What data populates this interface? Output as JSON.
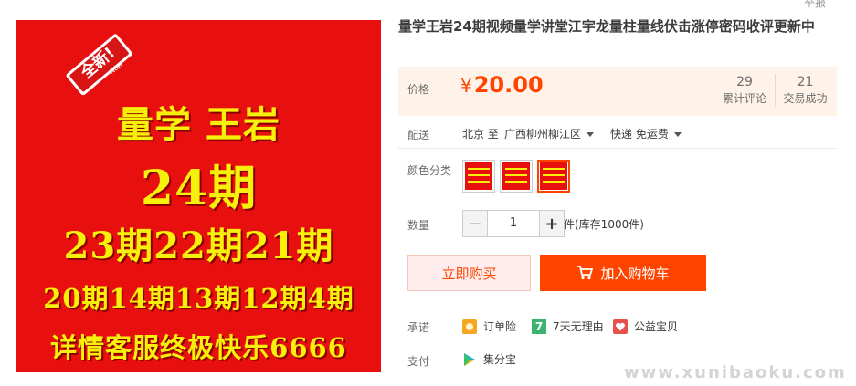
{
  "image": {
    "lines": [
      "量学   王岩",
      "24期",
      "23期22期21期",
      "20期14期13期12期4期",
      "详情客服终极快乐6666"
    ],
    "badge_text": "全新!",
    "badge_sub": "NEW"
  },
  "top_cut_text": "举报",
  "title": "量学王岩24期视频量学讲堂江宇龙量柱量线伏击涨停密码收评更新中",
  "price": {
    "label": "价格",
    "currency": "¥",
    "value": "20.00"
  },
  "stats": [
    {
      "num": "29",
      "label": "累计评论"
    },
    {
      "num": "21",
      "label": "交易成功"
    }
  ],
  "shipping": {
    "label": "配送",
    "from": "北京 至",
    "to": "广西柳州柳江区",
    "method": "快递 免运费"
  },
  "color": {
    "label": "颜色分类",
    "selected_index": 2
  },
  "quantity": {
    "label": "数量",
    "value": "1",
    "minus": "−",
    "plus": "+",
    "stock": "件(库存1000件)"
  },
  "buttons": {
    "buy_now": "立即购买",
    "add_cart": "加入购物车"
  },
  "promise": {
    "label": "承诺",
    "items": [
      "订单险",
      "7天无理由",
      "公益宝贝"
    ],
    "seven_icon_text": "7"
  },
  "payment": {
    "label": "支付",
    "method": "集分宝"
  },
  "watermark": "www.xunibaoku.com",
  "colors": {
    "accent": "#ff4400",
    "price_bg": "#fff2e8",
    "image_bg": "#e8100f",
    "image_text": "#f7f00a"
  }
}
